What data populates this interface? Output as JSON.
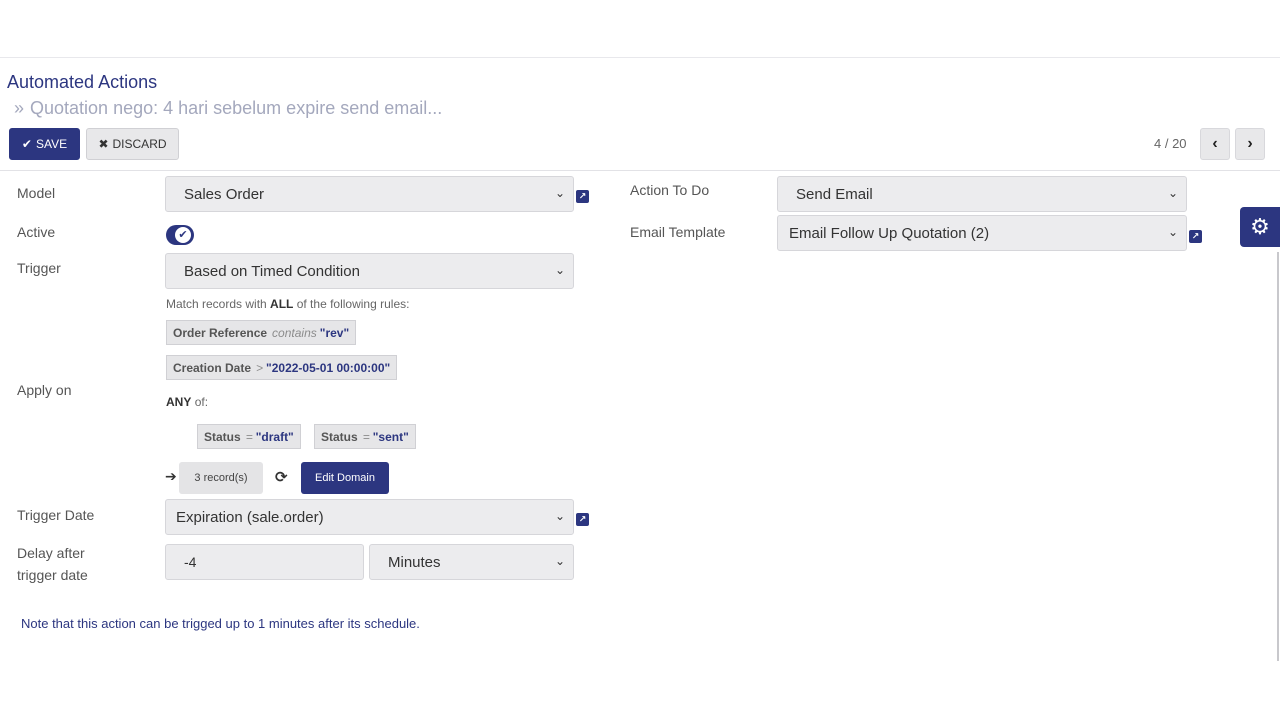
{
  "breadcrumb": {
    "root": "Automated Actions",
    "separator": "»",
    "current": "Quotation nego: 4 hari sebelum expire send email..."
  },
  "toolbar": {
    "save_label": "SAVE",
    "discard_label": "DISCARD"
  },
  "pager": {
    "value": "4 / 20"
  },
  "form": {
    "model_label": "Model",
    "model_value": "Sales Order",
    "active_label": "Active",
    "active_value": true,
    "trigger_label": "Trigger",
    "trigger_value": "Based on Timed Condition",
    "apply_on_label": "Apply on",
    "domain": {
      "match_prefix": "Match records with",
      "match_all": "ALL",
      "match_suffix": "of the following rules:",
      "rule1": {
        "field": "Order Reference",
        "op": "contains",
        "value": "\"rev\""
      },
      "rule2": {
        "field": "Creation Date",
        "op": ">",
        "value": "\"2022-05-01 00:00:00\""
      },
      "any_label": "ANY",
      "any_suffix": "of:",
      "rule3": {
        "field": "Status",
        "op": "=",
        "value": "\"draft\""
      },
      "rule4": {
        "field": "Status",
        "op": "=",
        "value": "\"sent\""
      },
      "records_label": "3 record(s)",
      "edit_domain_label": "Edit Domain"
    },
    "trigger_date_label": "Trigger Date",
    "trigger_date_value": "Expiration (sale.order)",
    "delay_label_line1": "Delay after",
    "delay_label_line2": "trigger date",
    "delay_value": "-4",
    "delay_unit": "Minutes",
    "action_label": "Action To Do",
    "action_value": "Send Email",
    "email_template_label": "Email Template",
    "email_template_value": "Email Follow Up Quotation (2)",
    "note": "Note that this action can be trigged up to 1 minutes after its schedule."
  },
  "icons": {
    "check": "✔",
    "cross": "✖",
    "prev": "‹",
    "next": "›",
    "caret": "⌄",
    "arrow": "➔",
    "refresh": "⟳",
    "gear": "⚙",
    "external": "↗"
  },
  "colors": {
    "primary": "#2c3680",
    "field_bg": "#ececee"
  }
}
